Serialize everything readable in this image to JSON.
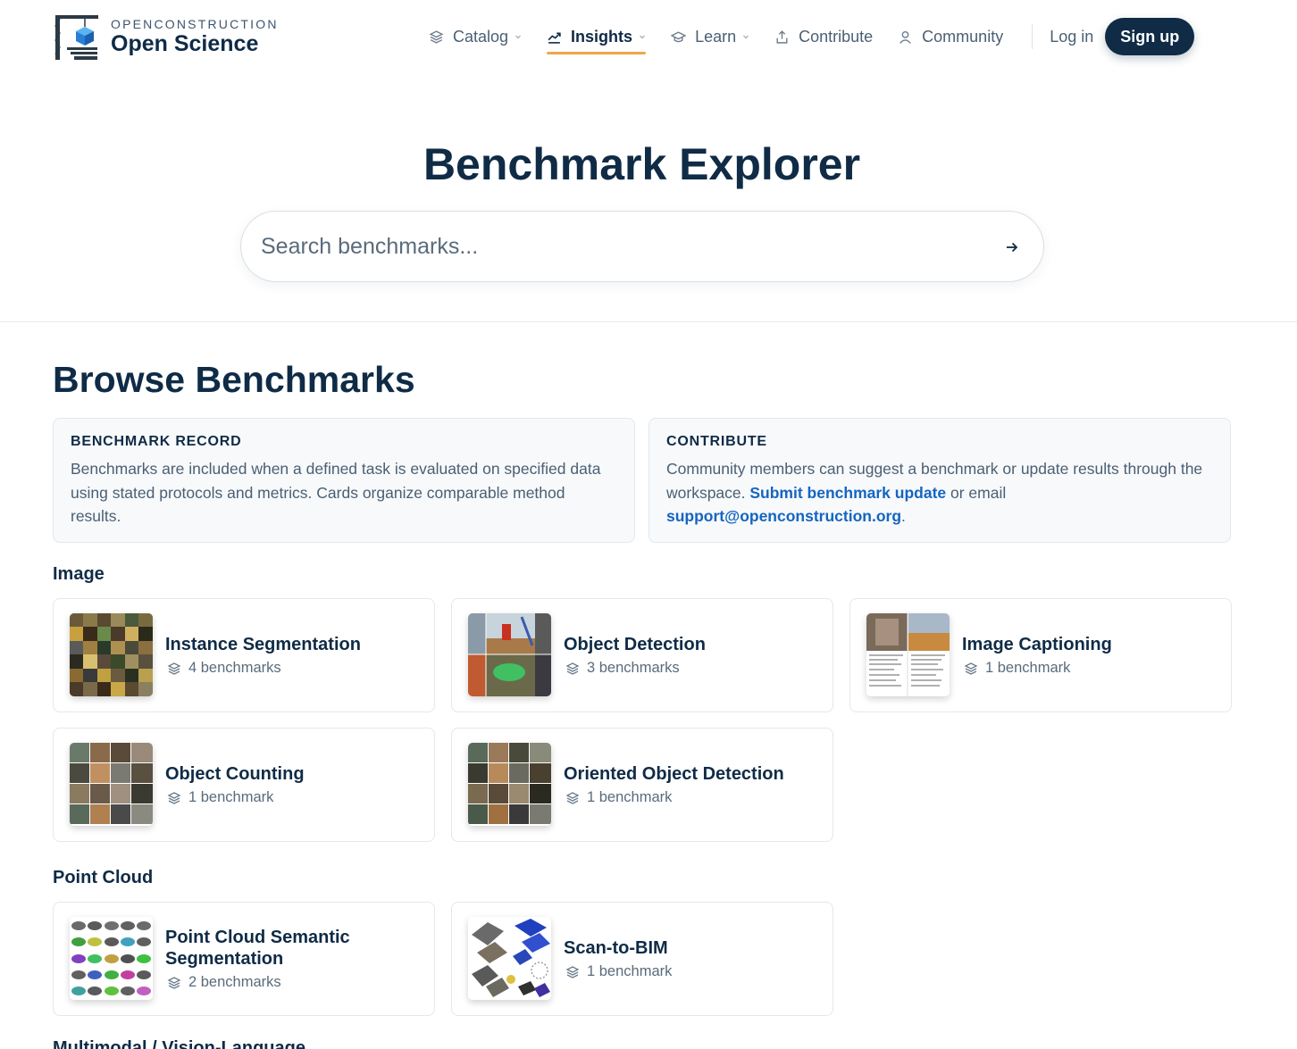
{
  "brand": {
    "sub": "OPENCONSTRUCTION",
    "name": "Open Science",
    "logo_icon": "crane-cube-logo"
  },
  "nav": {
    "items": [
      {
        "label": "Catalog",
        "icon": "layers-icon",
        "dropdown": true
      },
      {
        "label": "Insights",
        "icon": "trend-icon",
        "dropdown": true,
        "active": true
      },
      {
        "label": "Learn",
        "icon": "graduation-cap-icon",
        "dropdown": true
      },
      {
        "label": "Contribute",
        "icon": "upload-icon",
        "dropdown": false
      },
      {
        "label": "Community",
        "icon": "user-icon",
        "dropdown": false
      }
    ],
    "login": "Log in",
    "signup": "Sign up"
  },
  "hero": {
    "title": "Benchmark Explorer",
    "search_placeholder": "Search benchmarks..."
  },
  "browse": {
    "title": "Browse Benchmarks",
    "record": {
      "heading": "BENCHMARK RECORD",
      "text": "Benchmarks are included when a defined task is evaluated on specified data using stated protocols and metrics. Cards organize comparable method results."
    },
    "contribute": {
      "heading": "CONTRIBUTE",
      "text_before": "Community members can suggest a benchmark or update results through the workspace. ",
      "link": "Submit benchmark update",
      "text_middle": " or email ",
      "email": "support@openconstruction.org",
      "text_after": "."
    }
  },
  "sections": [
    {
      "title": "Image",
      "cards": [
        {
          "title": "Instance Segmentation",
          "count": "4 benchmarks"
        },
        {
          "title": "Object Detection",
          "count": "3 benchmarks"
        },
        {
          "title": "Image Captioning",
          "count": "1 benchmark"
        },
        {
          "title": "Object Counting",
          "count": "1 benchmark"
        },
        {
          "title": "Oriented Object Detection",
          "count": "1 benchmark"
        }
      ]
    },
    {
      "title": "Point Cloud",
      "cards": [
        {
          "title": "Point Cloud Semantic Segmentation",
          "count": "2 benchmarks"
        },
        {
          "title": "Scan-to-BIM",
          "count": "1 benchmark"
        }
      ]
    },
    {
      "title": "Multimodal / Vision-Language"
    }
  ],
  "colors": {
    "navy": "#0f2b46",
    "accent": "#f0a64a",
    "link": "#1565c0"
  }
}
